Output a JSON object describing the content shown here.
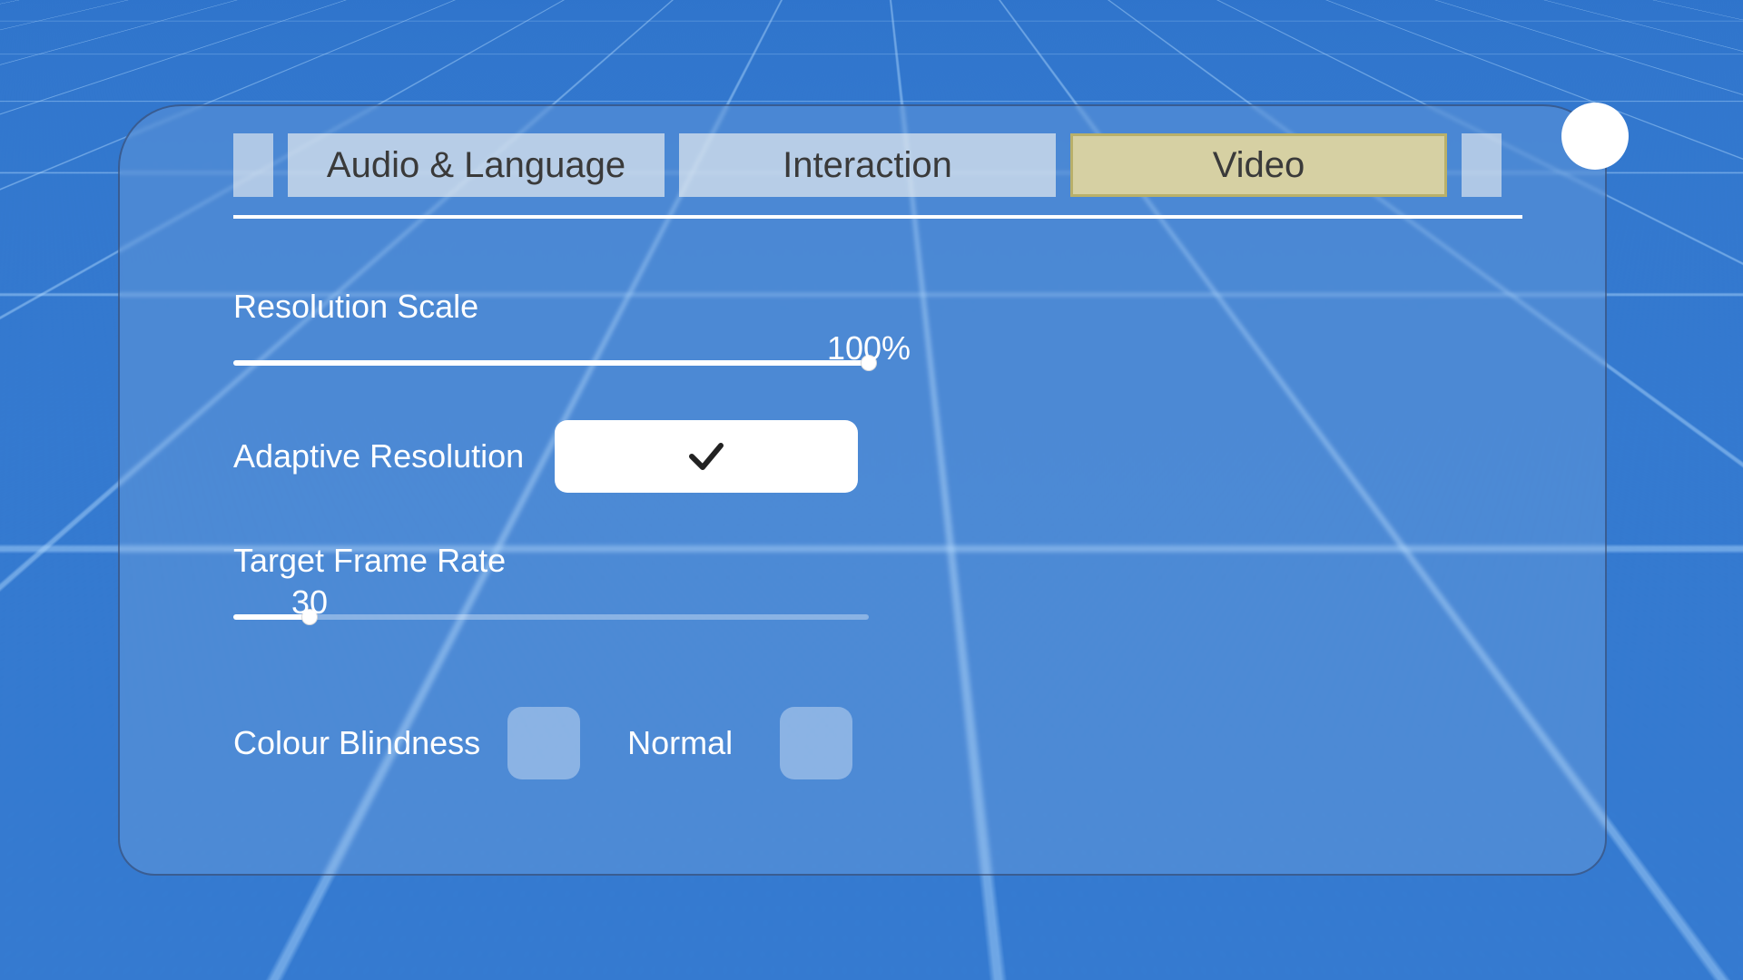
{
  "tabs": {
    "items": [
      {
        "label": "Audio & Language"
      },
      {
        "label": "Interaction"
      },
      {
        "label": "Video"
      }
    ],
    "active_index": 2
  },
  "settings": {
    "resolution_scale": {
      "label": "Resolution Scale",
      "value_text": "100%",
      "fill_pct": 100
    },
    "adaptive_resolution": {
      "label": "Adaptive Resolution",
      "checked": true
    },
    "target_frame_rate": {
      "label": "Target Frame Rate",
      "value_text": "30",
      "fill_pct": 12
    },
    "colour_blindness": {
      "label": "Colour Blindness",
      "value": "Normal"
    }
  }
}
